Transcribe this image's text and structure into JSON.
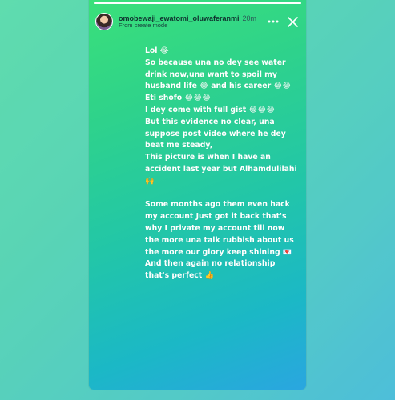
{
  "story": {
    "username": "omobewaji_ewatomi_oluwaferanmi",
    "time": "20m",
    "source": "From create mode",
    "progress": 1.0,
    "caption": "Lol 😂\nSo because una no dey see water drink now,una want to spoil my husband life 😂 and his career 😂😂\nEti shofo 😂😂😂\nI dey come with full gist 😂😂😂\nBut this evidence no clear, una suppose post video where he dey beat me steady,\nThis picture is when I have an accident last year but Alhamdulilahi 🙌\n\nSome months ago them even hack my account Just got it back that's why I private my account till now the more una talk rubbish about us the more our glory keep shining 💌\nAnd then again no relationship that's perfect 👍",
    "icons": {
      "menu": "more-dots-icon",
      "close": "close-icon"
    }
  },
  "colors": {
    "story_top": "#3ae07a",
    "story_bottom": "#2aa6e0",
    "text": "#ffffff"
  }
}
